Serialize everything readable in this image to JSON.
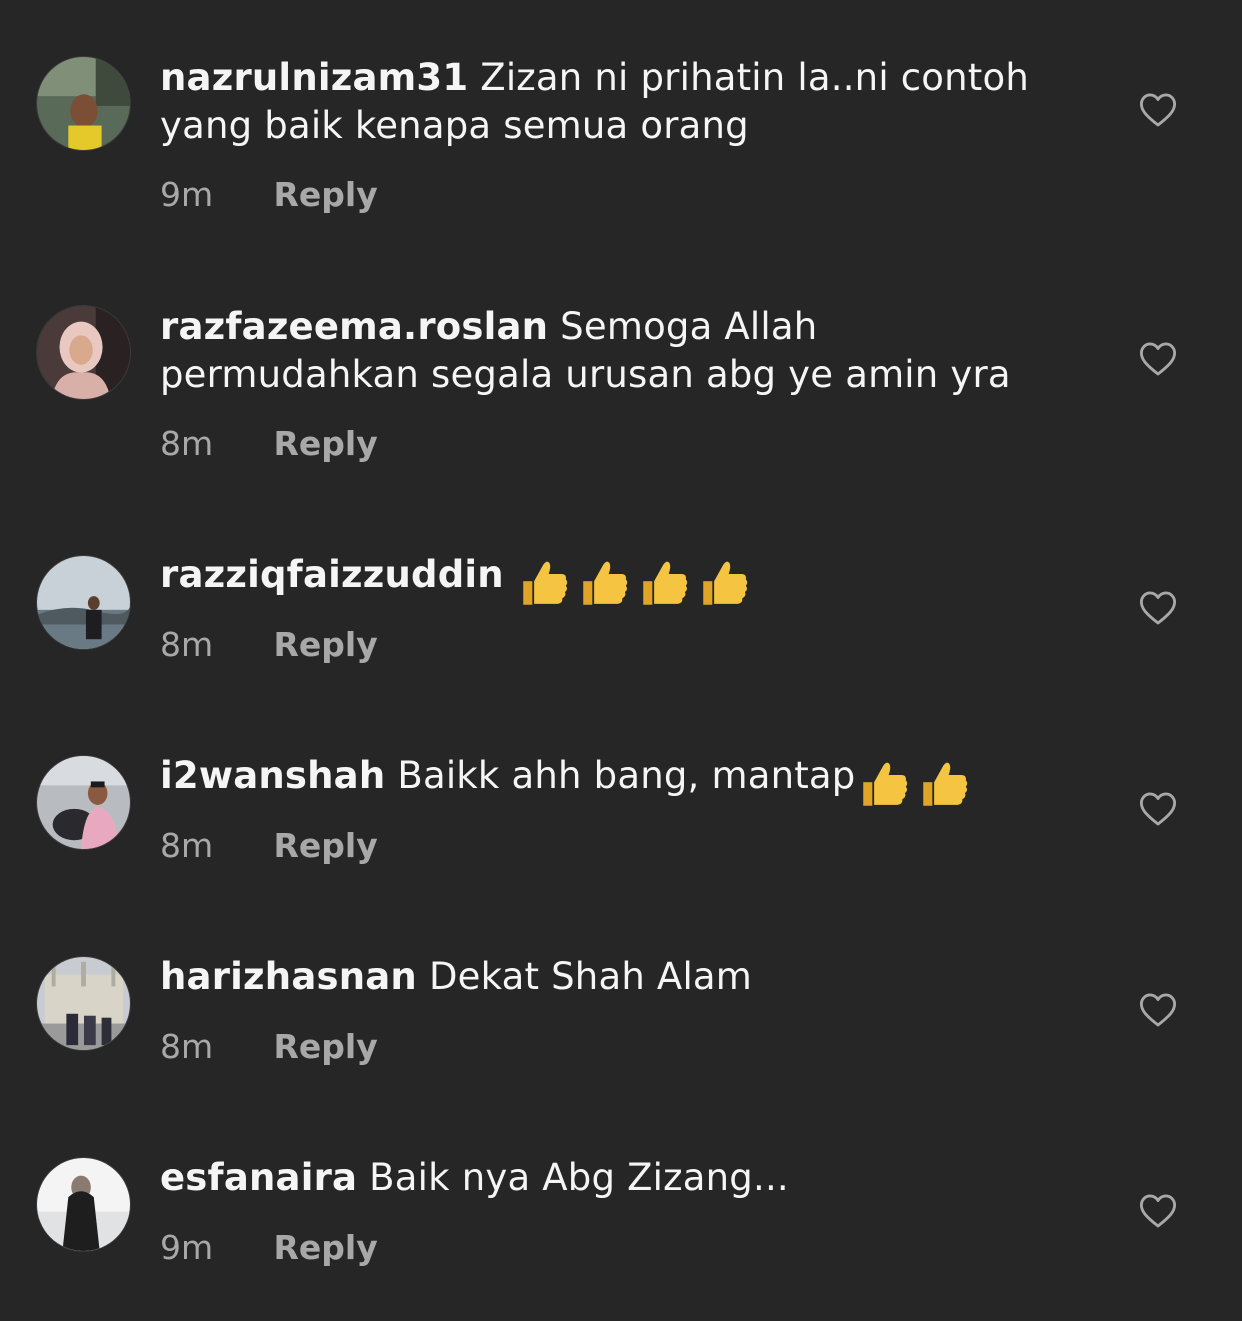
{
  "comments": [
    {
      "username": "nazrulnizam31",
      "text": "Zizan ni prihatin la..ni contoh yang baik kenapa semua orang",
      "time": "9m",
      "reply_label": "Reply",
      "avatar": "man-outdoor-yellow-shirt-avatar"
    },
    {
      "username": "razfazeema.roslan",
      "text": "Semoga Allah permudahkan segala urusan abg ye amin yra",
      "time": "8m",
      "reply_label": "Reply",
      "avatar": "woman-hijab-avatar"
    },
    {
      "username": "razziqfaizzuddin",
      "text": "👍👍👍👍",
      "time": "8m",
      "reply_label": "Reply",
      "avatar": "man-by-lake-avatar"
    },
    {
      "username": "i2wanshah",
      "text": "Baikk ahh bang, mantap👍👍",
      "time": "8m",
      "reply_label": "Reply",
      "avatar": "man-in-car-avatar"
    },
    {
      "username": "harizhasnan",
      "text": "Dekat Shah Alam",
      "time": "8m",
      "reply_label": "Reply",
      "avatar": "group-at-cathedral-avatar"
    },
    {
      "username": "esfanaira",
      "text": "Baik nya Abg Zizang...",
      "time": "9m",
      "reply_label": "Reply",
      "avatar": "woman-hijab-silhouette-avatar"
    }
  ],
  "colors": {
    "background": "#262626",
    "text": "#f5f5f5",
    "muted": "#a8a8a8",
    "thumb": "#f5c542"
  }
}
